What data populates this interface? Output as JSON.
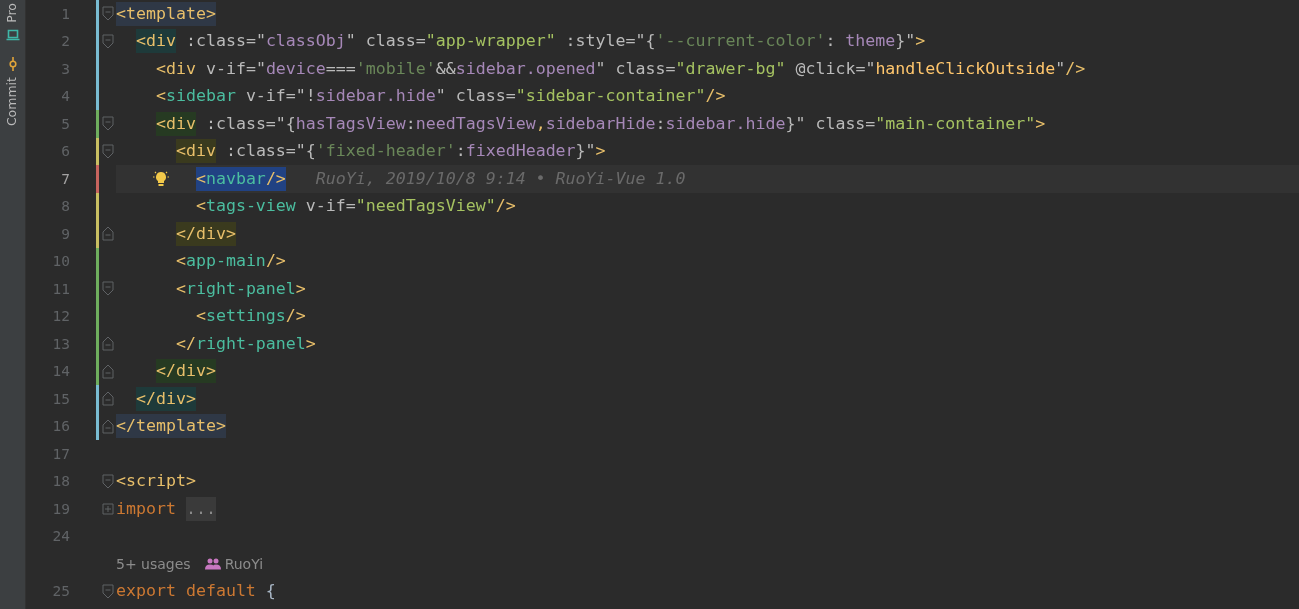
{
  "tool_strip": [
    {
      "label": "Pro",
      "kind": "project",
      "selected": false
    },
    {
      "label": "Commit",
      "kind": "commit",
      "selected": false
    }
  ],
  "lines": [
    {
      "kind": "code",
      "number": "1",
      "fold": {
        "kind": "start",
        "expanded": true
      },
      "color": "#79bcd2",
      "current": false,
      "tokens": [
        {
          "kind": "bracket",
          "text": "<",
          "color": "#2f3846"
        },
        {
          "kind": "tag",
          "text": "template",
          "color": "#2f3846"
        },
        {
          "kind": "bracket",
          "text": ">",
          "color": "#2f3846"
        }
      ],
      "children": [
        {
          "kind": "code",
          "number": "2",
          "fold": {
            "kind": "start",
            "expanded": true
          },
          "color": "#79bcd2",
          "current": false,
          "tokens": [
            {
              "kind": "bracket",
              "text": "<",
              "color": "#1e3a3a"
            },
            {
              "kind": "tag",
              "text": "div",
              "color": "#1e3a3a"
            },
            {
              "kind": "attr",
              "text": " :class=\""
            },
            {
              "kind": "expr",
              "text": "classObj"
            },
            {
              "kind": "attr",
              "text": "\" class="
            },
            {
              "kind": "string",
              "text": "\"app-wrapper\""
            },
            {
              "kind": "attr",
              "text": " :style=\"{"
            },
            {
              "kind": "literal",
              "text": "'--current-color'"
            },
            {
              "kind": "attr",
              "text": ": "
            },
            {
              "kind": "expr",
              "text": "theme"
            },
            {
              "kind": "attr",
              "text": "}\""
            },
            {
              "kind": "bracket",
              "text": ">"
            }
          ],
          "children": [
            {
              "kind": "code",
              "number": "3",
              "color": "#79bcd2",
              "current": false,
              "tokens": [
                {
                  "kind": "bracket",
                  "text": "<"
                },
                {
                  "kind": "tag",
                  "text": "div"
                },
                {
                  "kind": "attr",
                  "text": " v-if=\""
                },
                {
                  "kind": "expr",
                  "text": "device"
                },
                {
                  "kind": "attr",
                  "text": "==="
                },
                {
                  "kind": "literal",
                  "text": "'mobile'"
                },
                {
                  "kind": "attr",
                  "text": "&&"
                },
                {
                  "kind": "expr",
                  "text": "sidebar.opened"
                },
                {
                  "kind": "attr",
                  "text": "\" class="
                },
                {
                  "kind": "string",
                  "text": "\"drawer-bg\""
                },
                {
                  "kind": "attr",
                  "text": " @click=\""
                },
                {
                  "kind": "func",
                  "text": "handleClickOutside"
                },
                {
                  "kind": "attr",
                  "text": "\""
                },
                {
                  "kind": "bracket",
                  "text": "/>"
                }
              ]
            },
            {
              "kind": "code",
              "number": "4",
              "color": "#79bcd2",
              "current": false,
              "tokens": [
                {
                  "kind": "bracket",
                  "text": "<"
                },
                {
                  "kind": "component",
                  "text": "sidebar"
                },
                {
                  "kind": "attr",
                  "text": " v-if=\"!"
                },
                {
                  "kind": "expr",
                  "text": "sidebar.hide"
                },
                {
                  "kind": "attr",
                  "text": "\" class="
                },
                {
                  "kind": "string",
                  "text": "\"sidebar-container\""
                },
                {
                  "kind": "bracket",
                  "text": "/>"
                }
              ]
            },
            {
              "kind": "code",
              "number": "5",
              "fold": {
                "kind": "start",
                "expanded": true
              },
              "color": "#6fae5e",
              "current": false,
              "tokens": [
                {
                  "kind": "bracket",
                  "text": "<",
                  "color": "#263a22"
                },
                {
                  "kind": "tag",
                  "text": "div",
                  "color": "#263a22"
                },
                {
                  "kind": "attr",
                  "text": " :class=\"{"
                },
                {
                  "kind": "expr",
                  "text": "hasTagsView"
                },
                {
                  "kind": "attr",
                  "text": ":"
                },
                {
                  "kind": "expr",
                  "text": "needTagsView"
                },
                {
                  "kind": "bracket",
                  "text": ","
                },
                {
                  "kind": "expr",
                  "text": "sidebarHide"
                },
                {
                  "kind": "attr",
                  "text": ":"
                },
                {
                  "kind": "expr",
                  "text": "sidebar.hide"
                },
                {
                  "kind": "attr",
                  "text": "}\" class="
                },
                {
                  "kind": "string",
                  "text": "\"main-container\""
                },
                {
                  "kind": "bracket",
                  "text": ">"
                }
              ],
              "children": [
                {
                  "kind": "code",
                  "number": "6",
                  "fold": {
                    "kind": "start",
                    "expanded": true
                  },
                  "color": "#c9bf62",
                  "current": false,
                  "tokens": [
                    {
                      "kind": "bracket",
                      "text": "<",
                      "color": "#3a3a1e"
                    },
                    {
                      "kind": "tag",
                      "text": "div",
                      "color": "#3a3a1e"
                    },
                    {
                      "kind": "attr",
                      "text": " :class=\"{"
                    },
                    {
                      "kind": "literal",
                      "text": "'fixed-header'"
                    },
                    {
                      "kind": "attr",
                      "text": ":"
                    },
                    {
                      "kind": "expr",
                      "text": "fixedHeader"
                    },
                    {
                      "kind": "attr",
                      "text": "}\""
                    },
                    {
                      "kind": "bracket",
                      "text": ">"
                    }
                  ],
                  "children": [
                    {
                      "kind": "code",
                      "number": "7",
                      "color": "#c8645e",
                      "current": true,
                      "tokens": [
                        {
                          "kind": "bracket",
                          "text": "<",
                          "color": "#214283"
                        },
                        {
                          "kind": "component",
                          "text": "navbar",
                          "color": "#214283"
                        },
                        {
                          "kind": "bracket",
                          "text": "/>",
                          "color": "#214283"
                        },
                        {
                          "kind": "blame",
                          "text": "RuoYi, 2019/10/8 9:14 • RuoYi-Vue 1.0"
                        }
                      ]
                    },
                    {
                      "kind": "code",
                      "number": "8",
                      "color": "#c9bf62",
                      "current": false,
                      "tokens": [
                        {
                          "kind": "bracket",
                          "text": "<"
                        },
                        {
                          "kind": "component",
                          "text": "tags-view"
                        },
                        {
                          "kind": "attr",
                          "text": " v-if="
                        },
                        {
                          "kind": "string",
                          "text": "\"needTagsView\""
                        },
                        {
                          "kind": "bracket",
                          "text": "/>"
                        }
                      ]
                    }
                  ]
                },
                {
                  "kind": "code",
                  "number": "9",
                  "fold": {
                    "kind": "end"
                  },
                  "color": "#c9bf62",
                  "current": false,
                  "tokens": [
                    {
                      "kind": "bracket",
                      "text": "</div>",
                      "color": "#3a3a1e"
                    }
                  ]
                },
                {
                  "kind": "code",
                  "number": "10",
                  "color": "#6fae5e",
                  "current": false,
                  "tokens": [
                    {
                      "kind": "bracket",
                      "text": "<"
                    },
                    {
                      "kind": "component",
                      "text": "app-main"
                    },
                    {
                      "kind": "bracket",
                      "text": "/>"
                    }
                  ]
                },
                {
                  "kind": "code",
                  "number": "11",
                  "fold": {
                    "kind": "start",
                    "expanded": true
                  },
                  "color": "#6fae5e",
                  "current": false,
                  "tokens": [
                    {
                      "kind": "bracket",
                      "text": "<"
                    },
                    {
                      "kind": "component",
                      "text": "right-panel"
                    },
                    {
                      "kind": "bracket",
                      "text": ">"
                    }
                  ],
                  "children": [
                    {
                      "kind": "code",
                      "number": "12",
                      "color": "#6fae5e",
                      "current": false,
                      "tokens": [
                        {
                          "kind": "bracket",
                          "text": "<"
                        },
                        {
                          "kind": "component",
                          "text": "settings"
                        },
                        {
                          "kind": "bracket",
                          "text": "/>"
                        }
                      ]
                    }
                  ]
                },
                {
                  "kind": "code",
                  "number": "13",
                  "fold": {
                    "kind": "end"
                  },
                  "color": "#6fae5e",
                  "current": false,
                  "tokens": [
                    {
                      "kind": "bracket",
                      "text": "</"
                    },
                    {
                      "kind": "component",
                      "text": "right-panel"
                    },
                    {
                      "kind": "bracket",
                      "text": ">"
                    }
                  ]
                }
              ]
            },
            {
              "kind": "code",
              "number": "14",
              "fold": {
                "kind": "end"
              },
              "color": "#6fae5e",
              "current": false,
              "tokens": [
                {
                  "kind": "bracket",
                  "text": "</div>",
                  "color": "#263a22"
                }
              ]
            }
          ]
        },
        {
          "kind": "code",
          "number": "15",
          "fold": {
            "kind": "end"
          },
          "color": "#79bcd2",
          "current": false,
          "tokens": [
            {
              "kind": "bracket",
              "text": "</div>",
              "color": "#1e3a3a"
            }
          ]
        }
      ]
    },
    {
      "kind": "code",
      "number": "16",
      "fold": {
        "kind": "end"
      },
      "color": "#79bcd2",
      "current": false,
      "tokens": [
        {
          "kind": "bracket",
          "text": "</template>",
          "color": "#2f3846"
        }
      ]
    },
    {
      "kind": "code",
      "number": "17",
      "current": false
    },
    {
      "kind": "code",
      "number": "18",
      "fold": {
        "kind": "start",
        "expanded": true
      },
      "current": false,
      "tokens": [
        {
          "kind": "bracket",
          "text": "<script>"
        }
      ]
    },
    {
      "kind": "code",
      "number": "19",
      "fold": {
        "kind": "start",
        "expanded": false
      },
      "current": false,
      "tokens": [
        {
          "kind": "keyword",
          "text": "import"
        },
        {
          "kind": "folded",
          "text": "..."
        }
      ]
    },
    {
      "kind": "code",
      "number": "24",
      "current": false
    },
    {
      "kind": "inlay",
      "usages": "5+ usages",
      "author": "RuoYi"
    },
    {
      "kind": "code",
      "number": "25",
      "fold": {
        "kind": "start",
        "expanded": true
      },
      "current": false,
      "tokens": [
        {
          "kind": "keyword",
          "text": "export default"
        },
        {
          "kind": "brace",
          "text": "{"
        }
      ]
    }
  ]
}
